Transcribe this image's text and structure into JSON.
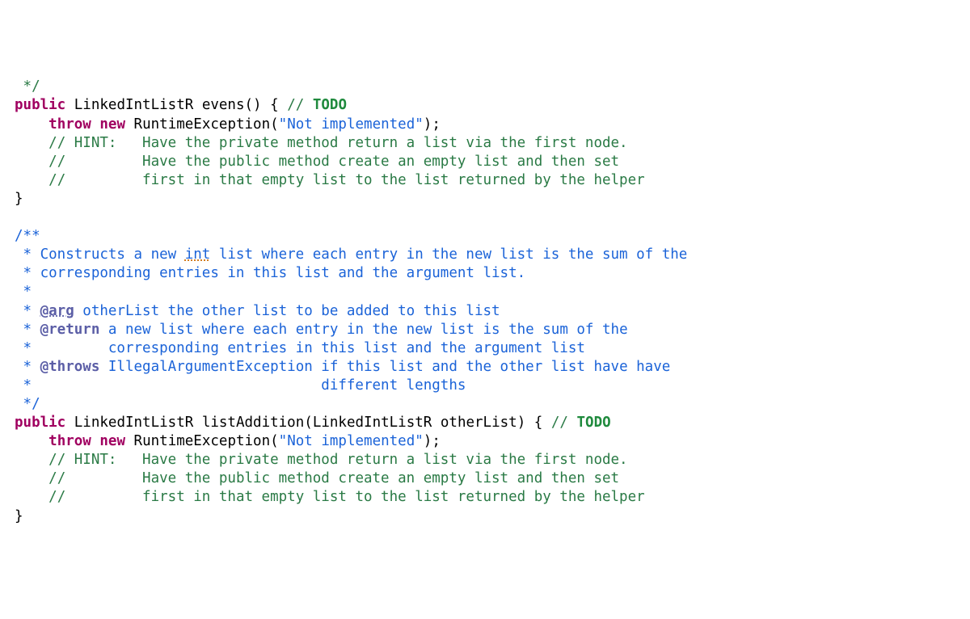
{
  "line01": " */",
  "evens": {
    "sigPublic": "public",
    "sigType": "LinkedIntListR",
    "sigName": "evens",
    "sigParen": "()",
    "sigBrace": "{",
    "sigSlashSlash": "//",
    "todo": "TODO",
    "throwKw": "throw",
    "newKw": "new",
    "exType": "RuntimeException",
    "open": "(",
    "str": "\"Not implemented\"",
    "close": ")",
    "semi": ";",
    "h1": "// HINT:   Have the private method return a list via the first node.",
    "h2": "//         Have the public method create an empty list and then set",
    "h3": "//         first in that empty list to the list returned by the helper",
    "closeBrace": "}"
  },
  "doc": {
    "open": "/**",
    "l1a": " * Constructs a new ",
    "l1int": "int",
    "l1b": " list where each entry in the new list is the sum of the",
    "l2": " * corresponding entries in this list and the argument list.",
    "l3": " *",
    "l4star": " * ",
    "l4tag": "@arg",
    "l4rest": " otherList the other list to be added to this list",
    "l5star": " * ",
    "l5tag": "@return",
    "l5rest": " a new list where each entry in the new list is the sum of the",
    "l6": " *         corresponding entries in this list and the argument list",
    "l7star": " * ",
    "l7tag": "@throws",
    "l7rest": " IllegalArgumentException if this list and the other list have have",
    "l8": " *                                  different lengths",
    "close": " */"
  },
  "listAdd": {
    "sigPublic": "public",
    "sigType": "LinkedIntListR",
    "sigName": "listAddition",
    "open": "(",
    "paramType": "LinkedIntListR",
    "paramName": "otherList",
    "close": ")",
    "brace": "{",
    "slashes": "//",
    "todo": "TODO",
    "throwKw": "throw",
    "newKw": "new",
    "exType": "RuntimeException",
    "p1": "(",
    "str": "\"Not implemented\"",
    "p2": ")",
    "semi": ";",
    "h1": "// HINT:   Have the private method return a list via the first node.",
    "h2": "//         Have the public method create an empty list and then set",
    "h3": "//         first in that empty list to the list returned by the helper",
    "closeBrace": "}"
  }
}
